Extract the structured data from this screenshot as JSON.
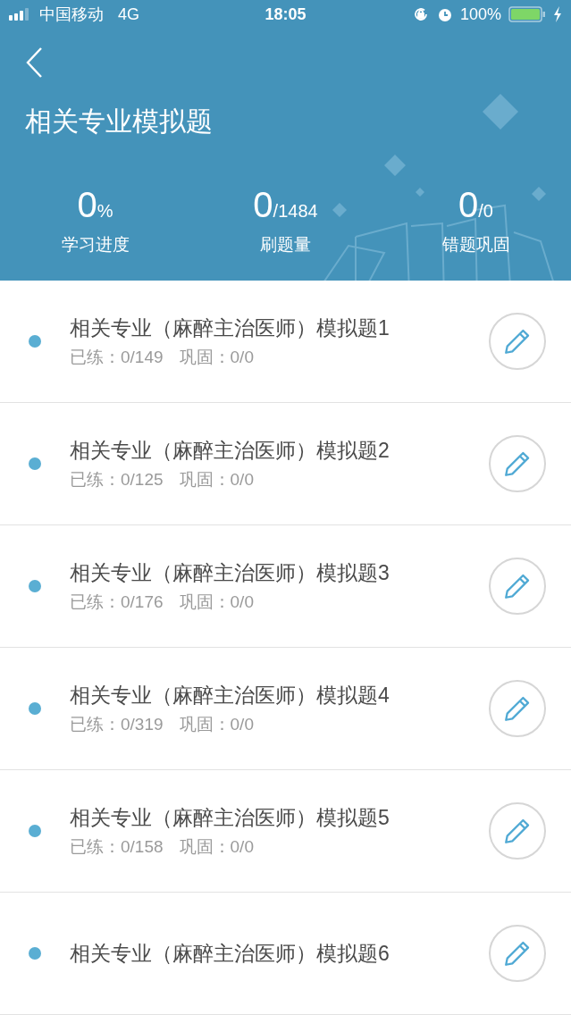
{
  "status_bar": {
    "carrier": "中国移动",
    "network": "4G",
    "time": "18:05",
    "battery": "100%"
  },
  "header": {
    "title": "相关专业模拟题"
  },
  "stats": [
    {
      "value": "0",
      "suffix": "%",
      "label": "学习进度"
    },
    {
      "value": "0",
      "suffix": "/1484",
      "label": "刷题量"
    },
    {
      "value": "0",
      "suffix": "/0",
      "label": "错题巩固"
    }
  ],
  "items": [
    {
      "title": "相关专业（麻醉主治医师）模拟题1",
      "practiced": "已练：0/149",
      "review": "巩固：0/0"
    },
    {
      "title": "相关专业（麻醉主治医师）模拟题2",
      "practiced": "已练：0/125",
      "review": "巩固：0/0"
    },
    {
      "title": "相关专业（麻醉主治医师）模拟题3",
      "practiced": "已练：0/176",
      "review": "巩固：0/0"
    },
    {
      "title": "相关专业（麻醉主治医师）模拟题4",
      "practiced": "已练：0/319",
      "review": "巩固：0/0"
    },
    {
      "title": "相关专业（麻醉主治医师）模拟题5",
      "practiced": "已练：0/158",
      "review": "巩固：0/0"
    },
    {
      "title": "相关专业（麻醉主治医师）模拟题6"
    }
  ]
}
